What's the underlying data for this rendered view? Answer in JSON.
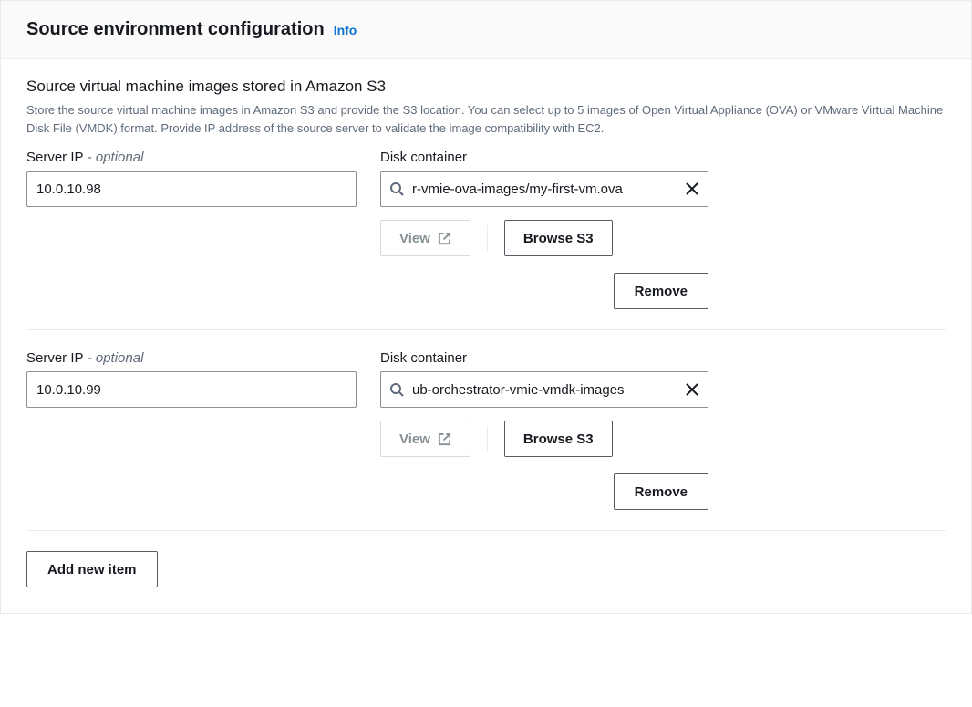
{
  "header": {
    "title": "Source environment configuration",
    "info_label": "Info"
  },
  "section": {
    "title": "Source virtual machine images stored in Amazon S3",
    "description": "Store the source virtual machine images in Amazon S3 and provide the S3 location. You can select up to 5 images of Open Virtual Appliance (OVA) or VMware Virtual Machine Disk File (VMDK) format. Provide IP address of the source server to validate the image compatibility with EC2."
  },
  "labels": {
    "server_ip": "Server IP",
    "optional": " - optional",
    "disk_container": "Disk container",
    "view": "View",
    "browse_s3": "Browse S3",
    "remove": "Remove",
    "add_new_item": "Add new item"
  },
  "items": [
    {
      "server_ip": "10.0.10.98",
      "disk_container": "r-vmie-ova-images/my-first-vm.ova"
    },
    {
      "server_ip": "10.0.10.99",
      "disk_container": "ub-orchestrator-vmie-vmdk-images"
    }
  ]
}
